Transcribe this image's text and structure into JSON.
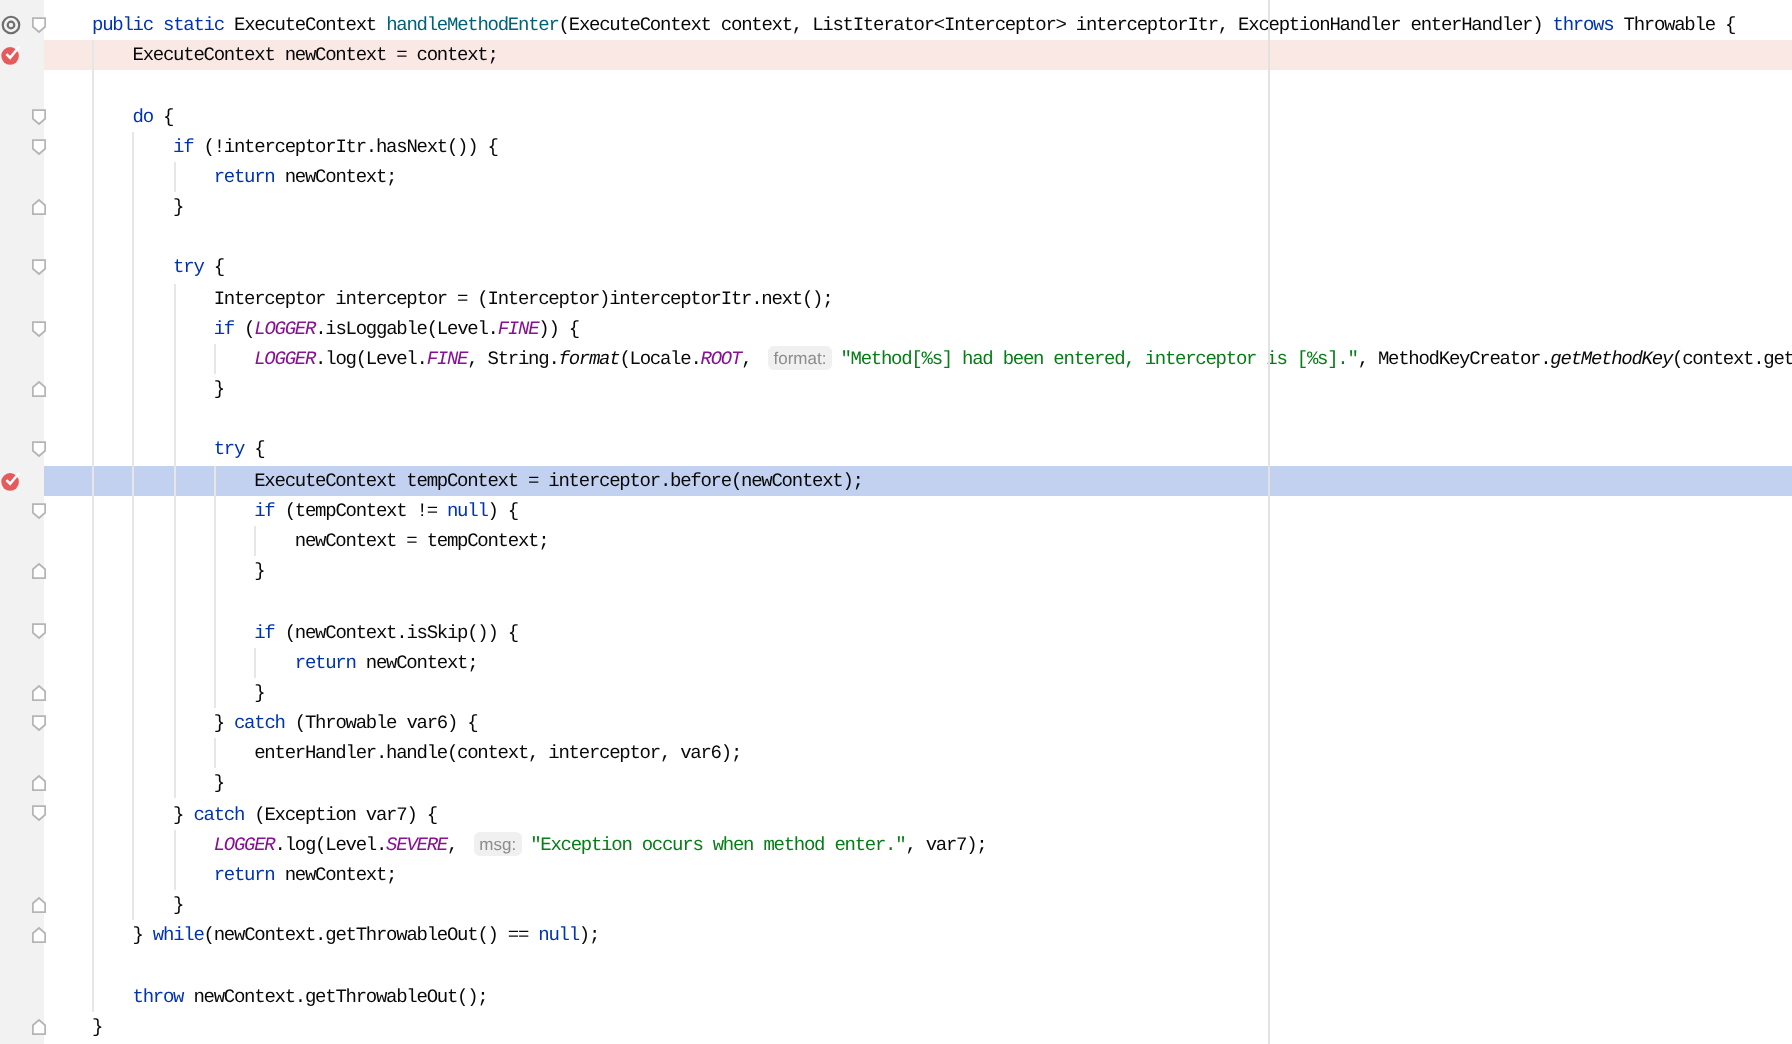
{
  "editor": {
    "lines": [
      {
        "override_marker": true,
        "fold_start": true,
        "tokens": [
          {
            "kind": "kw",
            "text": "public static"
          },
          {
            "kind": "plain",
            "text": " ExecuteContext "
          },
          {
            "kind": "decl",
            "text": "handleMethodEnter"
          },
          {
            "kind": "plain",
            "text": "(ExecuteContext context, ListIterator<Interceptor> interceptorItr, ExceptionHandler enterHandler) "
          },
          {
            "kind": "kw",
            "text": "throws"
          },
          {
            "kind": "plain",
            "text": " Throwable {"
          }
        ]
      },
      {
        "breakpoint": true,
        "tokens": [
          {
            "kind": "plain",
            "text": "    ExecuteContext newContext = context;"
          }
        ]
      },
      {
        "blank_before": true,
        "fold_start": true,
        "tokens": [
          {
            "kind": "kw",
            "text": "    do"
          },
          {
            "kind": "plain",
            "text": " {"
          }
        ]
      },
      {
        "fold_start": true,
        "tokens": [
          {
            "kind": "kw",
            "text": "        if"
          },
          {
            "kind": "plain",
            "text": " (!interceptorItr.hasNext()) {"
          }
        ]
      },
      {
        "tokens": [
          {
            "kind": "kw",
            "text": "            return"
          },
          {
            "kind": "plain",
            "text": " newContext;"
          }
        ]
      },
      {
        "fold_end": true,
        "tokens": [
          {
            "kind": "plain",
            "text": "        }"
          }
        ]
      },
      {
        "blank_before": true,
        "fold_start": true,
        "tokens": [
          {
            "kind": "kw",
            "text": "        try"
          },
          {
            "kind": "plain",
            "text": " {"
          }
        ]
      },
      {
        "tokens": [
          {
            "kind": "plain",
            "text": "            Interceptor interceptor = (Interceptor)interceptorItr.next();"
          }
        ]
      },
      {
        "fold_start": true,
        "tokens": [
          {
            "kind": "kw",
            "text": "            if"
          },
          {
            "kind": "plain",
            "text": " ("
          },
          {
            "kind": "const",
            "text": "LOGGER"
          },
          {
            "kind": "plain",
            "text": ".isLoggable(Level."
          },
          {
            "kind": "const",
            "text": "FINE"
          },
          {
            "kind": "plain",
            "text": ")) {"
          }
        ]
      },
      {
        "tokens": [
          {
            "kind": "const",
            "text": "                LOGGER"
          },
          {
            "kind": "plain",
            "text": ".log(Level."
          },
          {
            "kind": "const",
            "text": "FINE"
          },
          {
            "kind": "plain",
            "text": ", String."
          },
          {
            "kind": "static",
            "text": "format"
          },
          {
            "kind": "plain",
            "text": "(Locale."
          },
          {
            "kind": "const",
            "text": "ROOT"
          },
          {
            "kind": "plain",
            "text": ", "
          },
          {
            "kind": "hint",
            "text": "format:"
          },
          {
            "kind": "string",
            "text": "\"Method[%s] had been entered, interceptor is [%s].\""
          },
          {
            "kind": "plain",
            "text": ", MethodKeyCreator."
          },
          {
            "kind": "static",
            "text": "getMethodKey"
          },
          {
            "kind": "plain",
            "text": "(context.get"
          }
        ]
      },
      {
        "fold_end": true,
        "tokens": [
          {
            "kind": "plain",
            "text": "            }"
          }
        ]
      },
      {
        "blank_before": true,
        "fold_start": true,
        "tokens": [
          {
            "kind": "kw",
            "text": "            try"
          },
          {
            "kind": "plain",
            "text": " {"
          }
        ]
      },
      {
        "breakpoint": true,
        "current": true,
        "tokens": [
          {
            "kind": "plain",
            "text": "                ExecuteContext tempContext = interceptor.before(newContext);"
          }
        ]
      },
      {
        "fold_start": true,
        "tokens": [
          {
            "kind": "kw",
            "text": "                if"
          },
          {
            "kind": "plain",
            "text": " (tempContext != "
          },
          {
            "kind": "kw",
            "text": "null"
          },
          {
            "kind": "plain",
            "text": ") {"
          }
        ]
      },
      {
        "tokens": [
          {
            "kind": "plain",
            "text": "                    newContext = tempContext;"
          }
        ]
      },
      {
        "fold_end": true,
        "tokens": [
          {
            "kind": "plain",
            "text": "                }"
          }
        ]
      },
      {
        "blank_before": true,
        "fold_start": true,
        "tokens": [
          {
            "kind": "kw",
            "text": "                if"
          },
          {
            "kind": "plain",
            "text": " (newContext.isSkip()) {"
          }
        ]
      },
      {
        "tokens": [
          {
            "kind": "kw",
            "text": "                    return"
          },
          {
            "kind": "plain",
            "text": " newContext;"
          }
        ]
      },
      {
        "fold_end": true,
        "tokens": [
          {
            "kind": "plain",
            "text": "                }"
          }
        ]
      },
      {
        "fold_start": true,
        "tokens": [
          {
            "kind": "plain",
            "text": "            } "
          },
          {
            "kind": "kw",
            "text": "catch"
          },
          {
            "kind": "plain",
            "text": " (Throwable var6) {"
          }
        ]
      },
      {
        "tokens": [
          {
            "kind": "plain",
            "text": "                enterHandler.handle(context, interceptor, var6);"
          }
        ]
      },
      {
        "fold_end": true,
        "tokens": [
          {
            "kind": "plain",
            "text": "            }"
          }
        ]
      },
      {
        "fold_start": true,
        "tokens": [
          {
            "kind": "plain",
            "text": "        } "
          },
          {
            "kind": "kw",
            "text": "catch"
          },
          {
            "kind": "plain",
            "text": " (Exception var7) {"
          }
        ]
      },
      {
        "tokens": [
          {
            "kind": "const",
            "text": "            LOGGER"
          },
          {
            "kind": "plain",
            "text": ".log(Level."
          },
          {
            "kind": "const",
            "text": "SEVERE"
          },
          {
            "kind": "plain",
            "text": ", "
          },
          {
            "kind": "hint",
            "text": "msg:"
          },
          {
            "kind": "string",
            "text": "\"Exception occurs when method enter.\""
          },
          {
            "kind": "plain",
            "text": ", var7);"
          }
        ]
      },
      {
        "tokens": [
          {
            "kind": "kw",
            "text": "            return"
          },
          {
            "kind": "plain",
            "text": " newContext;"
          }
        ]
      },
      {
        "fold_end": true,
        "tokens": [
          {
            "kind": "plain",
            "text": "        }"
          }
        ]
      },
      {
        "fold_end": true,
        "tokens": [
          {
            "kind": "plain",
            "text": "    } "
          },
          {
            "kind": "kw",
            "text": "while"
          },
          {
            "kind": "plain",
            "text": "(newContext.getThrowableOut() == "
          },
          {
            "kind": "kw",
            "text": "null"
          },
          {
            "kind": "plain",
            "text": ");"
          }
        ]
      },
      {
        "blank_before": true,
        "tokens": [
          {
            "kind": "kw",
            "text": "    throw"
          },
          {
            "kind": "plain",
            "text": " newContext.getThrowableOut();"
          }
        ]
      },
      {
        "fold_end": true,
        "tokens": [
          {
            "kind": "plain",
            "text": "}"
          }
        ]
      }
    ]
  }
}
